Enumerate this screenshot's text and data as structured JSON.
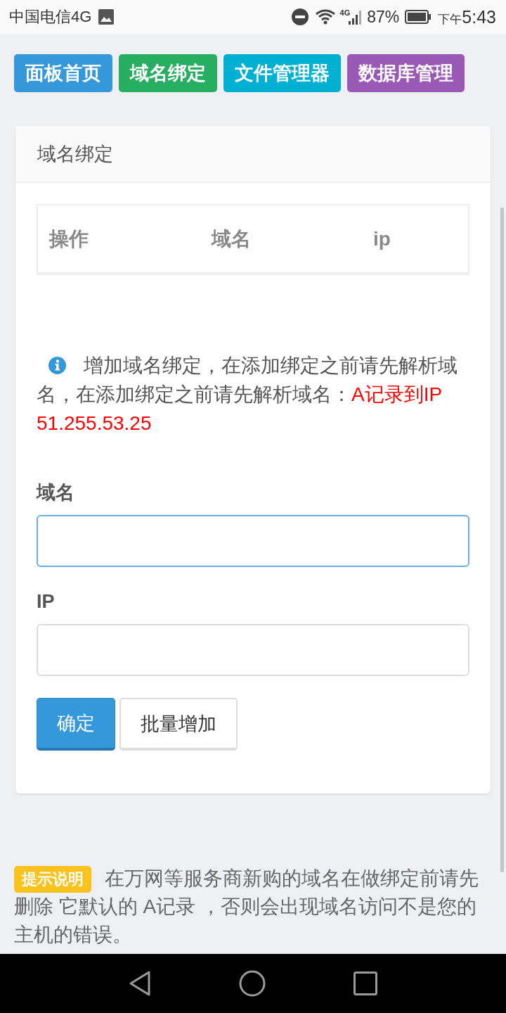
{
  "status_bar": {
    "carrier": "中国电信4G",
    "network": "4G",
    "battery": "87%",
    "period": "下午",
    "time": "5:43"
  },
  "nav_buttons": [
    {
      "label": "面板首页",
      "color": "#3498db"
    },
    {
      "label": "域名绑定",
      "color": "#27ae60"
    },
    {
      "label": "文件管理器",
      "color": "#00b0d3"
    },
    {
      "label": "数据库管理",
      "color": "#9b59b6"
    }
  ],
  "panel": {
    "title": "域名绑定",
    "table": {
      "columns": [
        "操作",
        "域名",
        "ip"
      ]
    },
    "notice": {
      "text": "增加域名绑定，在添加绑定之前请先解析域名，在添加绑定之前请先解析域名：",
      "highlight": "A记录到IP 51.255.53.25"
    },
    "form": {
      "fields": [
        {
          "label": "域名",
          "focused": true
        },
        {
          "label": "IP",
          "focused": false
        }
      ],
      "buttons": [
        {
          "label": "确定",
          "kind": "primary"
        },
        {
          "label": "批量增加",
          "kind": "default"
        }
      ]
    }
  },
  "tip": {
    "badge": "提示说明",
    "text": "在万网等服务商新购的域名在做绑定前请先删除 它默认的 A记录 ，否则会出现域名访问不是您的主机的错误。"
  }
}
